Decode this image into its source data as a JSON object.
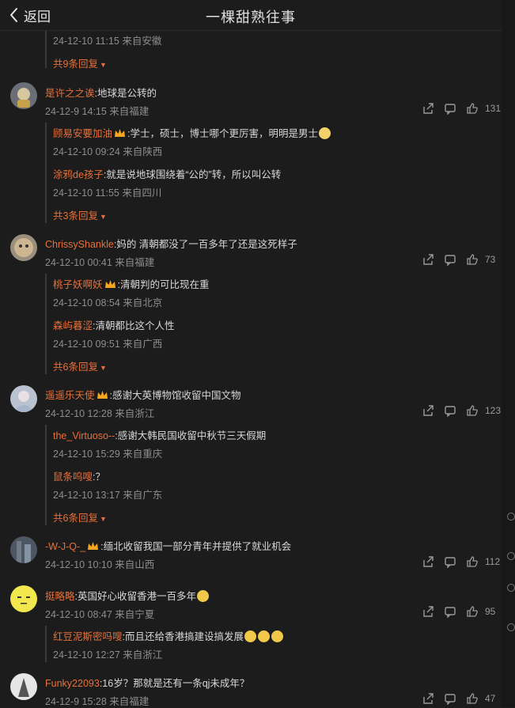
{
  "header": {
    "back_label": "返回",
    "title": "一棵甜熟往事"
  },
  "top_partial": {
    "meta": "24-12-10 11:15 来自安徽",
    "more": "共9条回复"
  },
  "comments": [
    {
      "user": "是许之之诶",
      "text": ":地球是公转的",
      "meta": "24-12-9 14:15 来自福建",
      "likes": "131",
      "replies": [
        {
          "user": "顾易安要加油",
          "text": ":学士，硕士，博士哪个更厉害，明明是男士",
          "meta": "24-12-10 09:24 来自陕西"
        },
        {
          "user": "涂鸦de孩子",
          "text": ":就是说地球围绕着“公的”转，所以叫公转",
          "meta": "24-12-10 11:55 来自四川"
        }
      ],
      "more": "共3条回复"
    },
    {
      "user": "ChrissyShankle",
      "text": ":妈的 清朝都没了一百多年了还是这死样子",
      "meta": "24-12-10 00:41 来自福建",
      "likes": "73",
      "replies": [
        {
          "user": "桃子妖啊妖",
          "text": ":清朝判的可比现在重",
          "meta": "24-12-10 08:54 来自北京"
        },
        {
          "user": "森屿暮涩",
          "text": ":清朝都比这个人性",
          "meta": "24-12-10 09:51 来自广西"
        }
      ],
      "more": "共6条回复"
    },
    {
      "user": "遥遥乐天使",
      "text": ":感谢大英博物馆收留中国文物",
      "meta": "24-12-10 12:28 来自浙江",
      "likes": "123",
      "replies": [
        {
          "user": "the_Virtuoso--",
          "text": ":感谢大韩民国收留中秋节三天假期",
          "meta": "24-12-10 15:29 来自重庆"
        },
        {
          "user": "鼠条呜嗖",
          "text": ":？",
          "meta": "24-12-10 13:17 来自广东"
        }
      ],
      "more": "共6条回复"
    },
    {
      "user": "-W-J-Q-_",
      "text": ":缅北收留我国一部分青年并提供了就业机会",
      "meta": "24-12-10 10:10 来自山西",
      "likes": "112",
      "replies": [],
      "more": ""
    },
    {
      "user": "挺略略",
      "text": ":英国好心收留香港一百多年",
      "meta": "24-12-10 08:47 来自宁夏",
      "likes": "95",
      "replies": [
        {
          "user": "红豆泥斯密吗嗖",
          "text": ":而且还给香港搞建设搞发展",
          "meta": "24-12-10 12:27 来自浙江"
        }
      ],
      "more": ""
    },
    {
      "user": "Funky22093",
      "text": ":16岁？那就是还有一条qj未成年？",
      "meta": "24-12-9 15:28 来自福建",
      "likes": "47",
      "replies": [],
      "more": ""
    }
  ],
  "icons": [
    "chevron-left-icon",
    "share-icon",
    "comment-icon",
    "like-icon",
    "emoji-icon",
    "crown-badge-icon"
  ],
  "colors": {
    "background": "#1c1c1c",
    "accent": "#e8703a",
    "meta": "#8d8d8d",
    "text": "#d8d8d8"
  }
}
